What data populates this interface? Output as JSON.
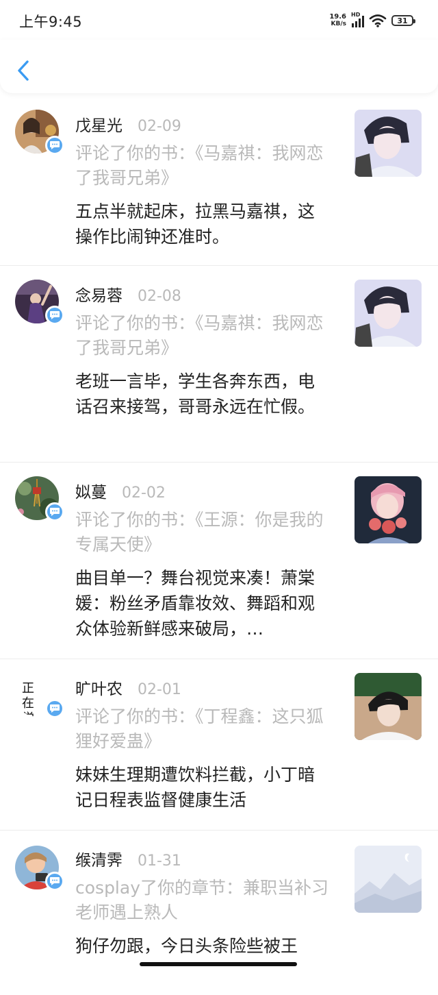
{
  "status_bar": {
    "time": "上午9:45",
    "net_speed_value": "19.6",
    "net_speed_unit": "KB/s",
    "hd_label": "HD",
    "battery": "31"
  },
  "nav": {
    "back_icon": "chevron-left-icon",
    "accent_color": "#3a9bf2"
  },
  "notifications": [
    {
      "name": "戊星光",
      "date": "02-09",
      "reference": "评论了你的书：《马嘉祺：我网恋了我哥兄弟》",
      "comment": "五点半就起床，拉黑马嘉祺，这操作比闹钟还准时。"
    },
    {
      "name": "念易蓉",
      "date": "02-08",
      "reference": "评论了你的书：《马嘉祺：我网恋了我哥兄弟》",
      "comment": "老班一言毕，学生各奔东西，电话召来接驾，哥哥永远在忙假。"
    },
    {
      "name": "姒蔓",
      "date": "02-02",
      "reference": "评论了你的书：《王源：你是我的专属天使》",
      "comment": "曲目单一？舞台视觉来凑！萧棠媛：粉丝矛盾靠妆效、舞蹈和观众体验新鲜感来破局，…"
    },
    {
      "name": "旷叶农",
      "date": "02-01",
      "avatar_text": "正在学习",
      "reference": "评论了你的书：《丁程鑫：这只狐狸好爱蛊》",
      "comment": "妹妹生理期遭饮料拦截，小丁暗记日程表监督健康生活"
    },
    {
      "name": "缑清霁",
      "date": "01-31",
      "reference": "cosplay了你的章节：兼职当补习老师遇上熟人",
      "comment": "狗仔勿跟，今日头条险些被王"
    }
  ],
  "icons": {
    "badge": "comment-bubble-icon",
    "badge_color": "#5aa9f0"
  }
}
